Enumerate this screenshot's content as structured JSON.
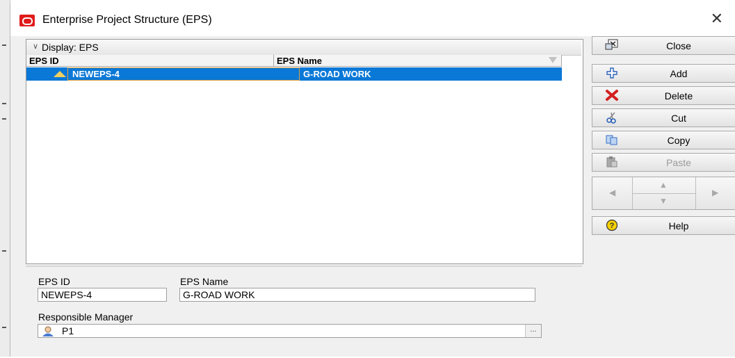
{
  "window": {
    "title": "Enterprise Project Structure (EPS)",
    "close_glyph": "✕"
  },
  "grid": {
    "display_label": "Display: EPS",
    "columns": [
      "EPS ID",
      "EPS Name"
    ],
    "rows": [
      {
        "eps_id": "NEWEPS-4",
        "eps_name": "G-ROAD WORK",
        "selected": true
      }
    ]
  },
  "buttons": {
    "close": "Close",
    "add": "Add",
    "delete": "Delete",
    "cut": "Cut",
    "copy": "Copy",
    "paste": "Paste",
    "help": "Help"
  },
  "details": {
    "eps_id_label": "EPS ID",
    "eps_id_value": "NEWEPS-4",
    "eps_name_label": "EPS Name",
    "eps_name_value": "G-ROAD WORK",
    "manager_label": "Responsible Manager",
    "manager_value": "P1",
    "ellipsis": "..."
  },
  "icons": {
    "close_button": "close-window-icon",
    "add": "add-plus-icon",
    "delete": "delete-x-icon",
    "cut": "scissors-icon",
    "copy": "copy-icon",
    "paste": "paste-clipboard-icon",
    "help": "help-question-icon",
    "eps_node": "eps-diamond-icon",
    "manager": "user-icon"
  },
  "colors": {
    "selection": "#0a78d7",
    "app_icon": "#e01b1b",
    "delete_icon": "#d42020"
  }
}
